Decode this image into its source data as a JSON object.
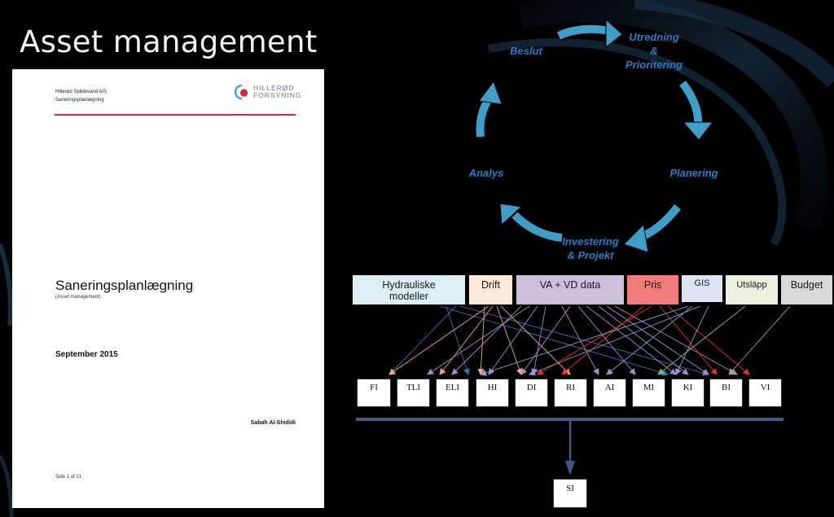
{
  "slide": {
    "title": "Asset management"
  },
  "document": {
    "company_line1": "Hillerød Spildevand A/S",
    "company_line2": "Saneringsplanlægning",
    "logo_line1": "HILLERØD",
    "logo_line2": "FORSYNING",
    "title": "Saneringsplanlægning",
    "subtitle": "(Asset management)",
    "date": "September 2015",
    "author": "Sabah Al-Shididi",
    "page_number": "Side 1 af 21",
    "accent_color": "#d9262e"
  },
  "cycle": {
    "stages": [
      {
        "id": "beslut",
        "label": "Beslut"
      },
      {
        "id": "utredning",
        "label": "Utredning\n&\nPrioritering"
      },
      {
        "id": "planering",
        "label": "Planering"
      },
      {
        "id": "investering",
        "label": "Investering\n& Projekt"
      },
      {
        "id": "analys",
        "label": "Analys"
      }
    ],
    "label_color": "#1f7fc8",
    "arrow_color": "#3d9ec7"
  },
  "data_sources": [
    {
      "id": "hydrauliske",
      "label": "Hydrauliske\nmodeller",
      "color": "#daeef3"
    },
    {
      "id": "drift",
      "label": "Drift",
      "color": "#fde9d9"
    },
    {
      "id": "vavd",
      "label": "VA + VD data",
      "color": "#ccc0da"
    },
    {
      "id": "pris",
      "label": "Pris",
      "color": "#f27c7c"
    },
    {
      "id": "gis",
      "label": "GIS",
      "color": "#dbe5f1"
    },
    {
      "id": "utslapp",
      "label": "Utsläpp",
      "color": "#ebf1de"
    },
    {
      "id": "budget",
      "label": "Budget",
      "color": "#d9d9d9"
    }
  ],
  "indices": [
    {
      "id": "fi",
      "label": "FI"
    },
    {
      "id": "tli",
      "label": "TLI"
    },
    {
      "id": "eli",
      "label": "ELI"
    },
    {
      "id": "hi",
      "label": "HI"
    },
    {
      "id": "di",
      "label": "DI"
    },
    {
      "id": "ri",
      "label": "RI"
    },
    {
      "id": "ai",
      "label": "AI"
    },
    {
      "id": "mi",
      "label": "MI"
    },
    {
      "id": "ki",
      "label": "KI"
    },
    {
      "id": "bi",
      "label": "BI"
    },
    {
      "id": "vi",
      "label": "VI"
    }
  ],
  "result": {
    "label": "SI"
  },
  "connector_color": "#3d5a8a",
  "connection_colors": [
    "#2e75b6",
    "#f4a38a",
    "#a78bc9",
    "#e8302f",
    "#7ba7d9",
    "#7fbf6a",
    "#9e9e9e"
  ]
}
